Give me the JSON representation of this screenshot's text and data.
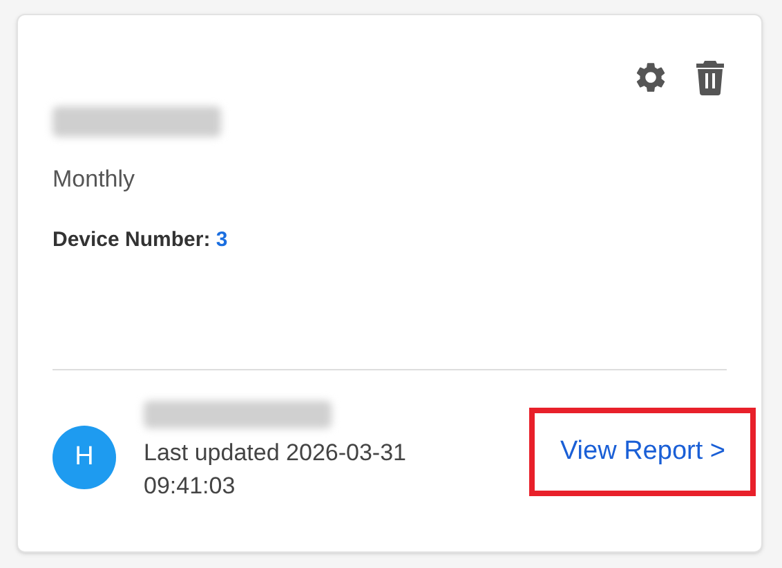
{
  "card": {
    "billing": "Monthly",
    "device_number_label": "Device Number:",
    "device_number": "3"
  },
  "footer": {
    "avatar_letter": "H",
    "last_updated": "Last updated 2026-03-31 09:41:03",
    "link": {
      "label": "View Report >",
      "highlighted": true
    }
  }
}
